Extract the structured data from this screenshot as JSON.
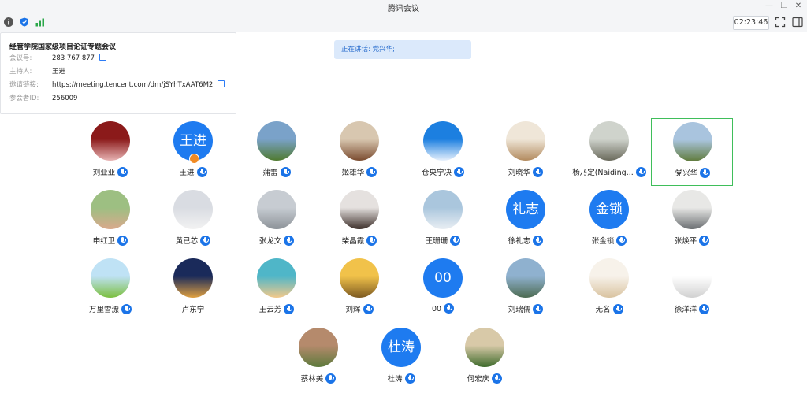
{
  "window": {
    "title": "腾讯会议"
  },
  "toolbar": {
    "timer": "02:23:46"
  },
  "meeting_info": {
    "title": "经管学院国家级项目论证专题会议",
    "rows": [
      {
        "label": "会议号:",
        "value": "283 767 877",
        "copy": true
      },
      {
        "label": "主持人:",
        "value": "王进",
        "copy": false
      },
      {
        "label": "邀请链接:",
        "value": "https://meeting.tencent.com/dm/jSYhTxAAT6M2",
        "copy": true
      },
      {
        "label": "参会者ID:",
        "value": "256009",
        "copy": false
      }
    ]
  },
  "speaking": "正在讲话: 党兴华;",
  "participants": [
    {
      "name": "刘亚亚",
      "avatar_colors": [
        "#8b1a1a",
        "#e8b4b4"
      ],
      "mic": true
    },
    {
      "name": "王进",
      "avatar_text": "王进",
      "mic": true,
      "host": true
    },
    {
      "name": "蒲雷",
      "avatar_colors": [
        "#7aa2c9",
        "#4f7a2f"
      ],
      "mic": true
    },
    {
      "name": "姬雄华",
      "avatar_colors": [
        "#d8c7b0",
        "#7a4b2f"
      ],
      "mic": true
    },
    {
      "name": "仓央宁决",
      "avatar_colors": [
        "#1c7fe0",
        "#e8f1fc"
      ],
      "mic": true
    },
    {
      "name": "刘晓华",
      "avatar_colors": [
        "#efe6d8",
        "#b28a5e"
      ],
      "mic": true
    },
    {
      "name": "杨乃定(Naiding...",
      "avatar_colors": [
        "#cfd3cc",
        "#6a6a5c"
      ],
      "mic": true
    },
    {
      "name": "党兴华",
      "avatar_colors": [
        "#a9c4de",
        "#5f7a3a"
      ],
      "mic": true,
      "active": true
    },
    {
      "name": "申红卫",
      "avatar_colors": [
        "#9dbf82",
        "#d9a98c"
      ],
      "mic": true
    },
    {
      "name": "黄已芯",
      "avatar_colors": [
        "#d9dce2",
        "#f2f2f2"
      ],
      "mic": true
    },
    {
      "name": "张龙文",
      "avatar_colors": [
        "#c7ccd2",
        "#8d9399"
      ],
      "mic": true
    },
    {
      "name": "柴晶霞",
      "avatar_colors": [
        "#e5e1df",
        "#3d2f2a"
      ],
      "mic": true
    },
    {
      "name": "王珊珊",
      "avatar_colors": [
        "#aac6dd",
        "#e9eef3"
      ],
      "mic": true
    },
    {
      "name": "徐礼志",
      "avatar_text": "礼志",
      "mic": true
    },
    {
      "name": "张金锁",
      "avatar_text": "金锁",
      "mic": true
    },
    {
      "name": "张焕平",
      "avatar_colors": [
        "#e8e8e6",
        "#6b6f72"
      ],
      "mic": true
    },
    {
      "name": "万里雪漂",
      "avatar_colors": [
        "#bfe2f5",
        "#7bbf3e"
      ],
      "mic": true
    },
    {
      "name": "卢东宁",
      "avatar_colors": [
        "#1a2a5a",
        "#e0a040"
      ],
      "mic": false
    },
    {
      "name": "王云芳",
      "avatar_colors": [
        "#4fb6c8",
        "#f3c98a"
      ],
      "mic": true
    },
    {
      "name": "刘辉",
      "avatar_colors": [
        "#f1c24a",
        "#7d5a22"
      ],
      "mic": true
    },
    {
      "name": "00",
      "avatar_text": "00",
      "mic": true
    },
    {
      "name": "刘瑞儒",
      "avatar_colors": [
        "#8fb1cf",
        "#4d6b52"
      ],
      "mic": true
    },
    {
      "name": "无名",
      "avatar_colors": [
        "#f7f2ea",
        "#d9c3a0"
      ],
      "mic": true
    },
    {
      "name": "徐洋洋",
      "avatar_colors": [
        "#ffffff",
        "#d1d1d1"
      ],
      "mic": true
    },
    {
      "name": "蔡林美",
      "avatar_colors": [
        "#b58a6c",
        "#5d7a3c"
      ],
      "mic": true
    },
    {
      "name": "杜涛",
      "avatar_text": "杜涛",
      "mic": true
    },
    {
      "name": "何宏庆",
      "avatar_colors": [
        "#d8c9a8",
        "#3f6b2c"
      ],
      "mic": true
    }
  ]
}
